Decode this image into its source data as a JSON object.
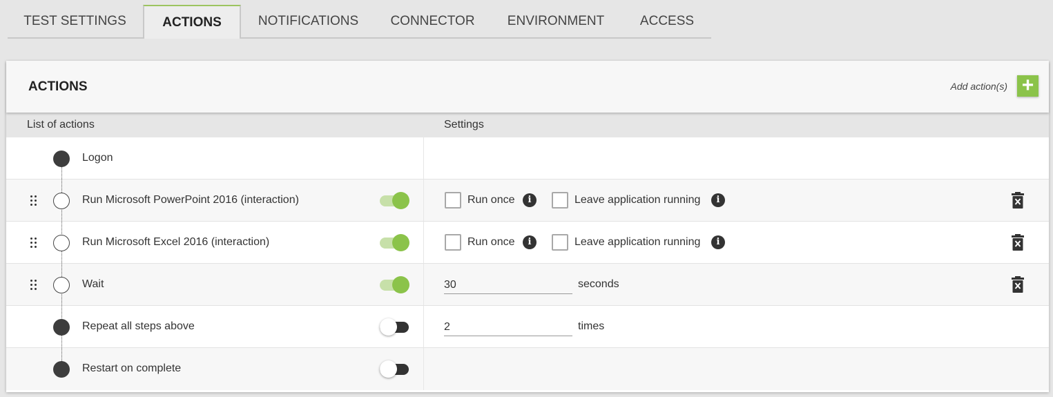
{
  "tabs": [
    {
      "label": "TEST SETTINGS"
    },
    {
      "label": "ACTIONS"
    },
    {
      "label": "NOTIFICATIONS"
    },
    {
      "label": "CONNECTOR"
    },
    {
      "label": "ENVIRONMENT"
    },
    {
      "label": "ACCESS"
    }
  ],
  "active_tab": "ACTIONS",
  "card": {
    "title": "ACTIONS",
    "add_label": "Add action(s)",
    "add_icon": "plus-icon"
  },
  "columns": {
    "list": "List of actions",
    "settings": "Settings"
  },
  "accent_color": "#8bc34a",
  "rows": [
    {
      "label": "Logon"
    },
    {
      "label": "Run Microsoft PowerPoint 2016 (interaction)",
      "enabled": true,
      "run_once_label": "Run once",
      "leave_running_label": "Leave application running"
    },
    {
      "label": "Run Microsoft Excel 2016 (interaction)",
      "enabled": true,
      "run_once_label": "Run once",
      "leave_running_label": "Leave application running"
    },
    {
      "label": "Wait",
      "enabled": true,
      "value": "30",
      "unit": "seconds"
    },
    {
      "label": "Repeat all steps above",
      "enabled": false,
      "value": "2",
      "unit": "times"
    },
    {
      "label": "Restart on complete",
      "enabled": false
    }
  ]
}
